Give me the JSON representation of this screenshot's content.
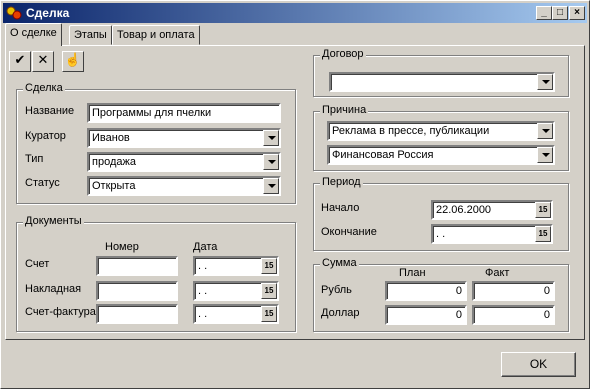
{
  "window": {
    "title": "Сделка",
    "min": "_",
    "max": "□",
    "close": "×"
  },
  "tabs": [
    "О сделке",
    "Этапы",
    "Товар и оплата"
  ],
  "toolbar": {
    "check": "✔",
    "cross": "✕",
    "hand": "☝"
  },
  "deal": {
    "title": "Сделка",
    "name_label": "Название",
    "name_value": "Программы для пчелки",
    "curator_label": "Куратор",
    "curator_value": "Иванов",
    "type_label": "Тип",
    "type_value": "продажа",
    "status_label": "Статус",
    "status_value": "Открыта"
  },
  "documents": {
    "title": "Документы",
    "col_number": "Номер",
    "col_date": "Дата",
    "rows": [
      {
        "label": "Счет",
        "number": "",
        "date": " .  ."
      },
      {
        "label": "Накладная",
        "number": "",
        "date": " .  ."
      },
      {
        "label": "Счет-фактура",
        "number": "",
        "date": " .  ."
      }
    ]
  },
  "contract": {
    "title": "Договор",
    "value": ""
  },
  "reason": {
    "title": "Причина",
    "value1": "Реклама в прессе, публикации",
    "value2": "Финансовая Россия"
  },
  "period": {
    "title": "Период",
    "start_label": "Начало",
    "start_value": "22.06.2000",
    "end_label": "Окончание",
    "end_value": " .  ."
  },
  "sum": {
    "title": "Сумма",
    "col_plan": "План",
    "col_fact": "Факт",
    "rows": [
      {
        "label": "Рубль",
        "plan": "0",
        "fact": "0"
      },
      {
        "label": "Доллар",
        "plan": "0",
        "fact": "0"
      }
    ]
  },
  "cal_glyph": "15",
  "ok": "OK"
}
